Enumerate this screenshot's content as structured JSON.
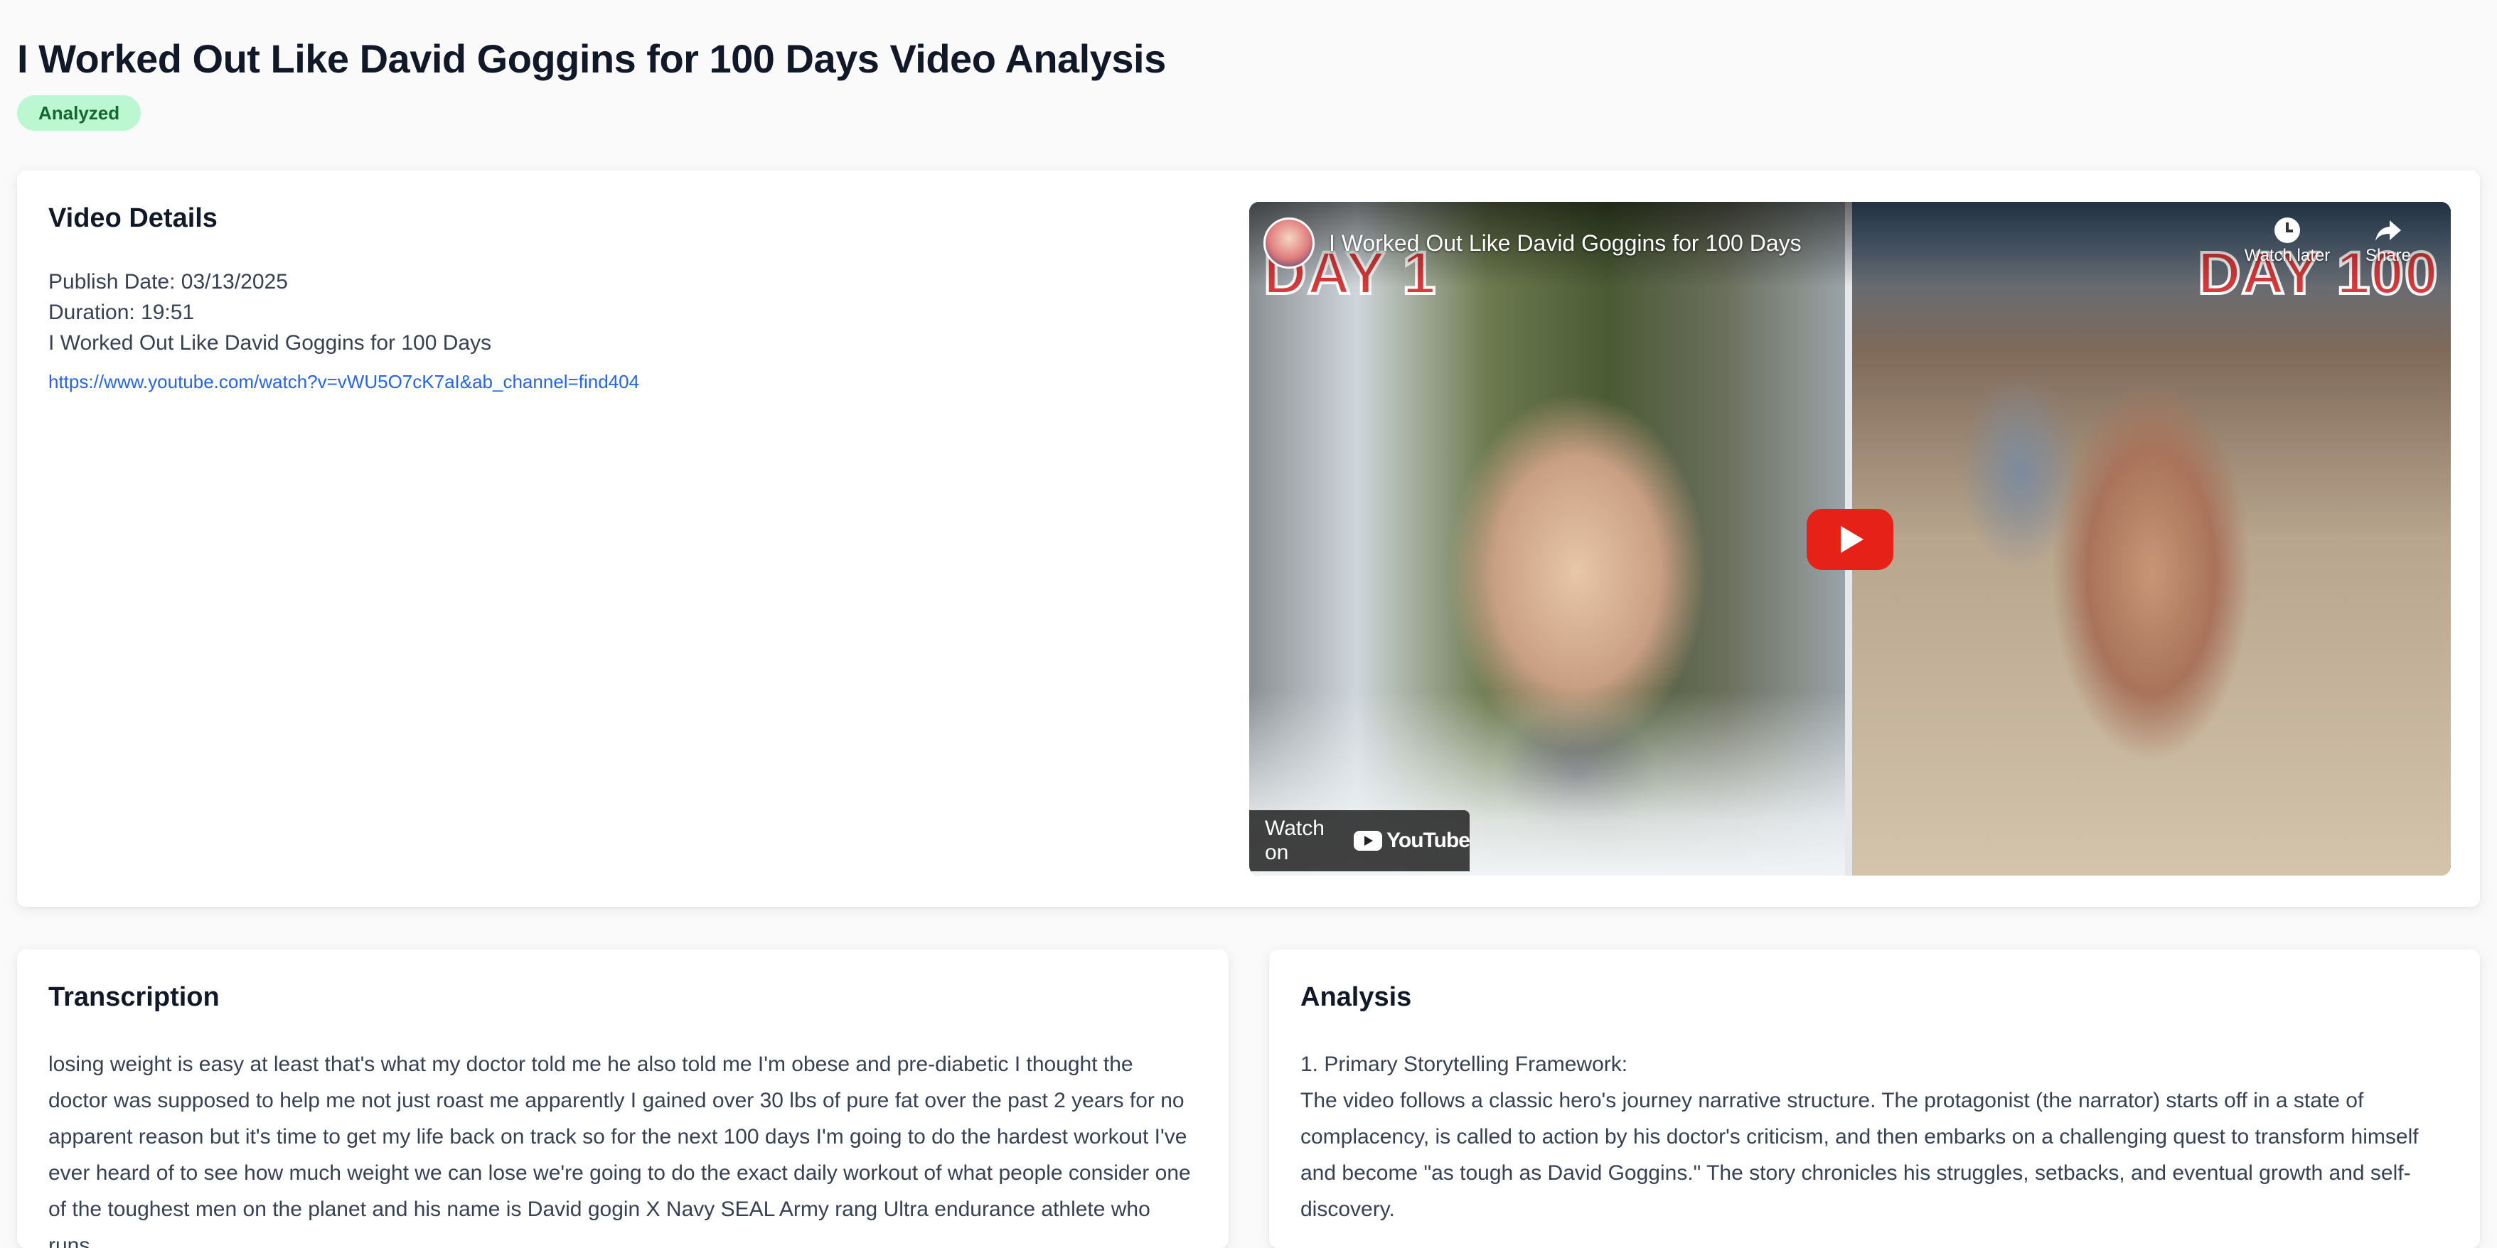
{
  "page": {
    "title": "I Worked Out Like David Goggins for 100 Days Video Analysis",
    "status": "Analyzed"
  },
  "details": {
    "heading": "Video Details",
    "publish_date": "Publish Date: 03/13/2025",
    "duration": "Duration: 19:51",
    "video_title": "I Worked Out Like David Goggins for 100 Days",
    "url": "https://www.youtube.com/watch?v=vWU5O7cK7aI&ab_channel=find404"
  },
  "video": {
    "title": "I Worked Out Like David Goggins for 100 Days",
    "day_left": "DAY 1",
    "day_right": "DAY 100",
    "watch_later_label": "Watch later",
    "share_label": "Share",
    "watch_on_label": "Watch on",
    "youtube_label": "YouTube",
    "icons": [
      "channel-avatar",
      "clock-icon",
      "share-icon",
      "play-icon",
      "youtube-logo-icon"
    ]
  },
  "transcription": {
    "heading": "Transcription",
    "text": "losing weight is easy at least that's what my doctor told me he also told me I'm obese and pre-diabetic I thought the doctor was supposed to help me not just roast me apparently I gained over 30 lbs of pure fat over the past 2 years for no apparent reason but it's time to get my life back on track so for the next 100 days I'm going to do the hardest workout I've ever heard of to see how much weight we can lose we're going to do the exact daily workout of what people consider one of the toughest men on the planet and his name is David gogin X Navy SEAL Army rang Ultra endurance athlete who runs"
  },
  "analysis": {
    "heading": "Analysis",
    "section_title": "1. Primary Storytelling Framework:",
    "text": "The video follows a classic hero's journey narrative structure. The protagonist (the narrator) starts off in a state of complacency, is called to action by his doctor's criticism, and then embarks on a challenging quest to transform himself and become \"as tough as David Goggins.\" The story chronicles his struggles, setbacks, and eventual growth and self-discovery."
  },
  "colors": {
    "badge_bg": "#bbf7d0",
    "badge_text": "#166534",
    "link": "#2563eb",
    "play_button": "#e62117",
    "day_label": "#d63a3a"
  }
}
